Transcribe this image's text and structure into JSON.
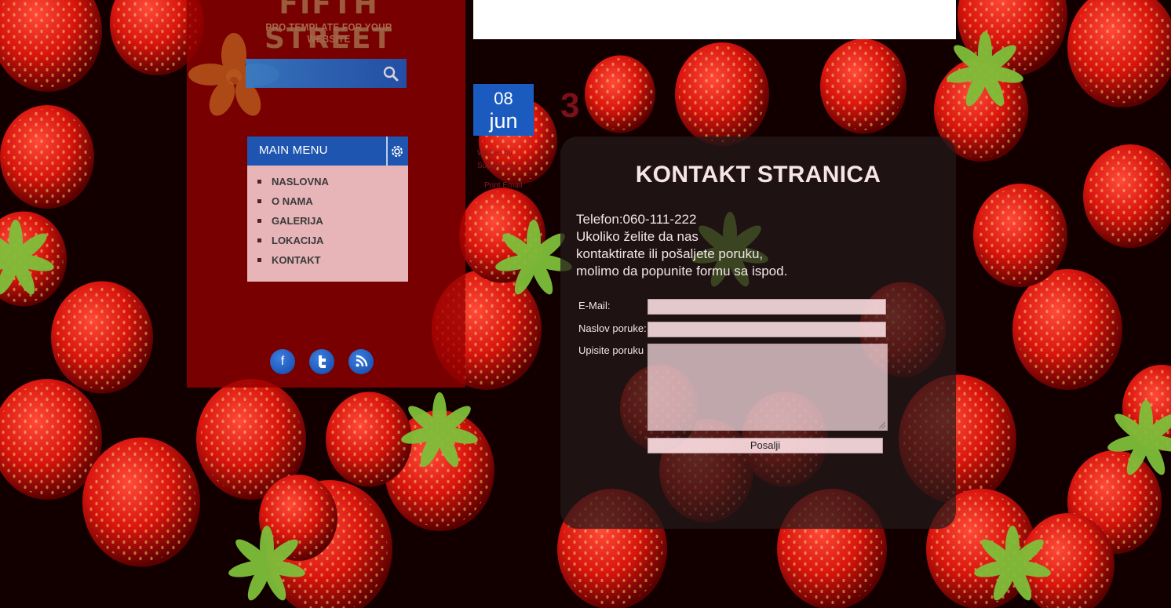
{
  "site": {
    "logo_title": "FIFTH STREET",
    "logo_subtitle": "PRO TEMPLATE FOR YOUR WEBSITE"
  },
  "search": {
    "placeholder": "",
    "icon": "search-icon"
  },
  "main_menu": {
    "title": "MAIN MENU",
    "settings_icon": "gear-icon",
    "items": [
      {
        "label": "NASLOVNA"
      },
      {
        "label": "O NAMA"
      },
      {
        "label": "GALERIJA"
      },
      {
        "label": "LOKACIJA"
      },
      {
        "label": "KONTAKT"
      }
    ]
  },
  "social": [
    {
      "icon": "facebook-icon",
      "glyph": "f"
    },
    {
      "icon": "twitter-icon",
      "glyph": "t"
    },
    {
      "icon": "rss-icon",
      "glyph": ""
    }
  ],
  "article": {
    "date_day": "08",
    "date_month": "jun",
    "written_by_line1": "Written by",
    "written_by_line2": "Super User",
    "actions": "Print Email",
    "hits_number": "3",
    "title": "KONTAKT STRANICA",
    "intro_lines": [
      "Telefon:060-111-222",
      "Ukoliko želite da nas",
      "kontaktirate ili pošaljete poruku,",
      "molimo da popunite formu sa ispod."
    ]
  },
  "form": {
    "email_label": "E-Mail:",
    "email_value": "",
    "subject_label": "Naslov poruke:",
    "subject_value": "",
    "message_label": "Upisite poruku",
    "message_value": "",
    "submit_label": "Posalji"
  },
  "colors": {
    "accent_blue": "#1e55b0",
    "sidebar_red": "#960000",
    "menu_bg": "#ffdce1"
  }
}
